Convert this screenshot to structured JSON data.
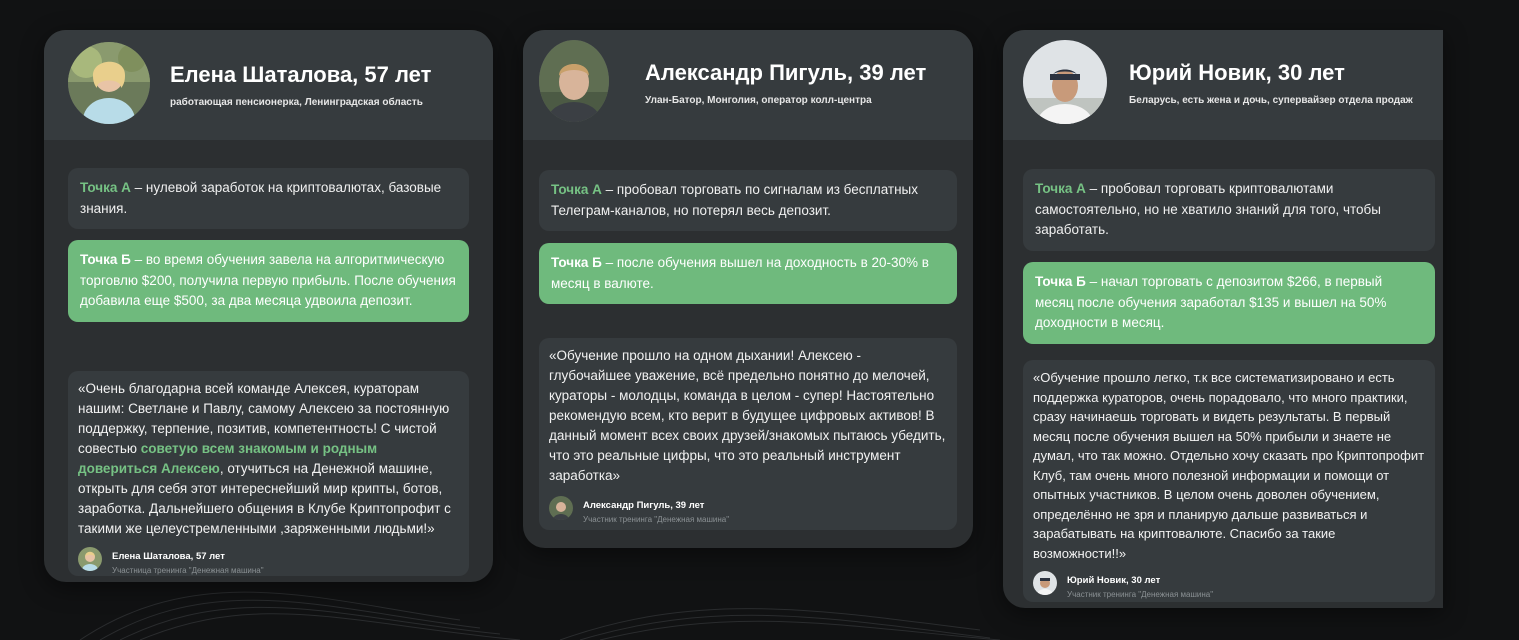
{
  "cards": [
    {
      "name": "Елена Шаталова, 57 лет",
      "subtitle": "работающая пенсионерка, Ленинградская область",
      "point_a_label": "Точка А",
      "point_a_text": " – нулевой заработок на криптовалютах, базовые знания.",
      "point_b_label": "Точка Б",
      "point_b_text": " – во время обучения завела на алгоритмическую торговлю $200, получила первую прибыль. После обучения добавила еще $500, за два месяца удвоила депозит.",
      "quote_part1": "«Очень благодарна всей команде Алексея, кураторам нашим: Светлане и Павлу, самому Алексею за постоянную поддержку, терпение, позитив, компетентность! С чистой совестью ",
      "quote_highlight": "советую всем знакомым и родным довериться Алексею",
      "quote_part2": ", отучиться на Денежной машине, открыть для себя этот интереснейший мир крипты, ботов, заработка. Дальнейшего общения в Клубе Криптопрофит с такими же целеустремленными ,заряженными людьми!»",
      "author_name": "Елена Шаталова, 57 лет",
      "author_role": "Участница тренинга \"Денежная машина\""
    },
    {
      "name": "Александр Пигуль, 39 лет",
      "subtitle": "Улан-Батор, Монголия, оператор колл-центра",
      "point_a_label": "Точка А",
      "point_a_text": " – пробовал торговать по сигналам из бесплатных Телеграм-каналов, но потерял весь депозит.",
      "point_b_label": "Точка Б",
      "point_b_text": " – после обучения вышел на доходность в 20-30% в месяц в валюте.",
      "quote": "«Обучение прошло на одном дыхании! Алексею - глубочайшее уважение, всё предельно понятно до мелочей, кураторы - молодцы, команда в целом - супер! Настоятельно рекомендую всем, кто верит в будущее цифровых активов! В данный момент всех своих друзей/знакомых пытаюсь убедить, что это реальные цифры, что это реальный инструмент заработка»",
      "author_name": "Александр Пигуль, 39 лет",
      "author_role": "Участник тренинга \"Денежная машина\""
    },
    {
      "name": "Юрий Новик, 30 лет",
      "subtitle": "Беларусь, есть жена и дочь, супервайзер отдела продаж",
      "point_a_label": "Точка А",
      "point_a_text": " – пробовал торговать криптовалютами самостоятельно, но не хватило знаний для того, чтобы заработать.",
      "point_b_label": "Точка Б",
      "point_b_text": " – начал торговать с депозитом $266, в первый месяц после обучения заработал $135 и вышел на 50% доходности в месяц.",
      "quote": "«Обучение прошло легко, т.к все систематизировано и есть поддержка кураторов, очень порадовало, что много практики, сразу начинаешь торговать и видеть результаты. В первый месяц после обучения вышел на 50% прибыли и знаете не думал, что так можно. Отдельно хочу сказать про Криптопрофит Клуб, там очень много полезной информации и помощи от опытных участников. В целом очень доволен обучением, определённо не зря и планирую дальше развиваться и зарабатывать на криптовалюте. Спасибо за такие возможности!!»",
      "author_name": "Юрий Новик, 30 лет",
      "author_role": "Участник тренинга \"Денежная машина\""
    }
  ],
  "colors": {
    "background": "#111213",
    "card": "#2c2f31",
    "panel": "#363b3e",
    "accent_green": "#6fba7d",
    "label_green": "#76c284"
  }
}
